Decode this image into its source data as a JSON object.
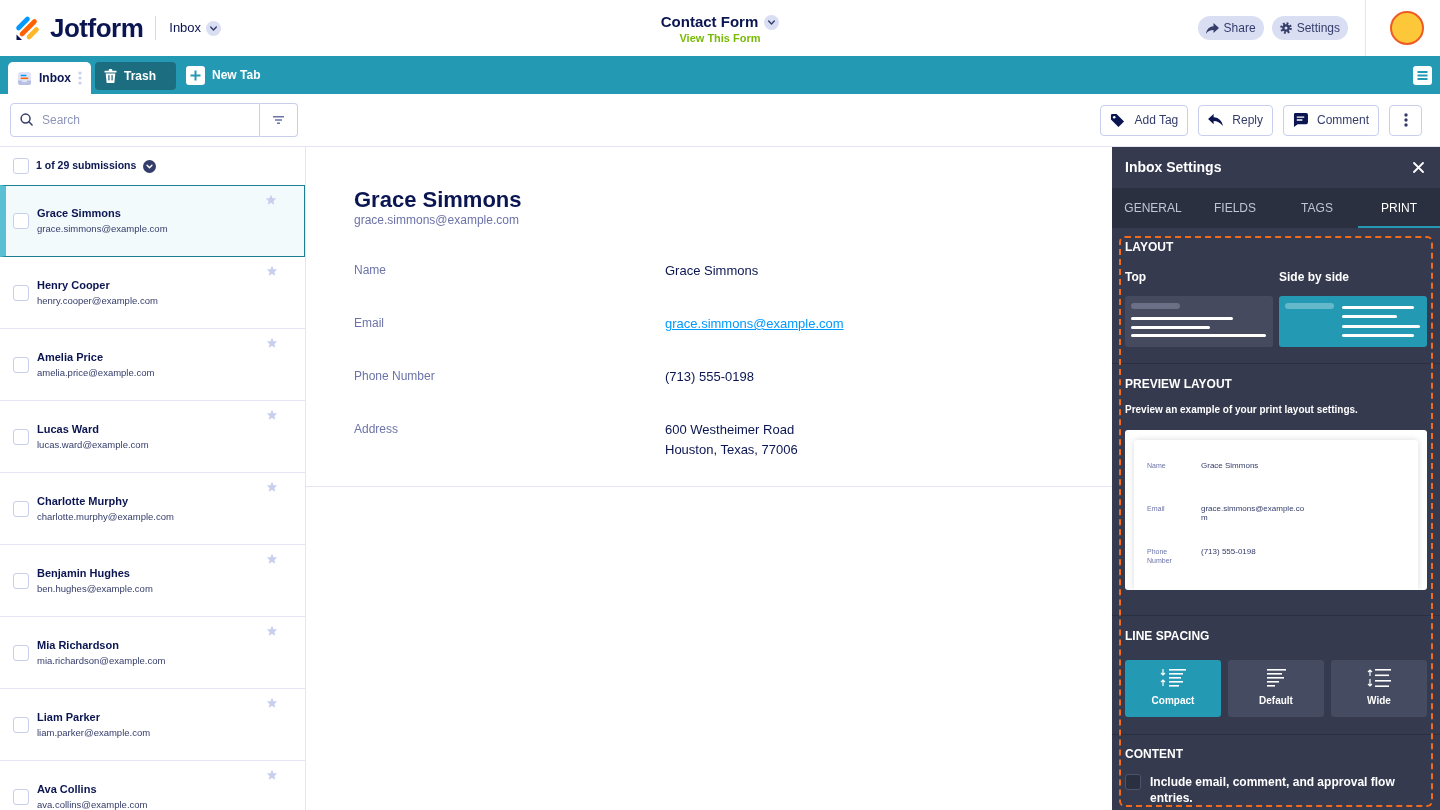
{
  "header": {
    "logo": "Jotform",
    "section_dropdown": "Inbox",
    "form_title": "Contact Form",
    "form_link": "View This Form",
    "buttons": [
      {
        "label": "Share",
        "kind": "share"
      },
      {
        "label": "Settings",
        "kind": "settings"
      }
    ]
  },
  "tabs": [
    {
      "label": "Inbox",
      "kind": "inbox",
      "selected": true
    },
    {
      "label": "Trash",
      "kind": "trash",
      "selected": false
    }
  ],
  "new_tab_button": "New Tab",
  "search": {
    "placeholder": "Search"
  },
  "actions": [
    {
      "label": "Add Tag",
      "kind": "tag"
    },
    {
      "label": "Reply",
      "kind": "reply"
    },
    {
      "label": "Comment",
      "kind": "comment"
    }
  ],
  "submissions": {
    "count": "1 of 29 submissions",
    "all_checked": false,
    "items": [
      {
        "name": "Grace Simmons",
        "email": "grace.simmons@example.com",
        "selected": true,
        "checked": false,
        "starred": false
      },
      {
        "name": "Henry Cooper",
        "email": "henry.cooper@example.com",
        "selected": false,
        "checked": false,
        "starred": false
      },
      {
        "name": "Amelia Price",
        "email": "amelia.price@example.com",
        "selected": false,
        "checked": false,
        "starred": false
      },
      {
        "name": "Lucas Ward",
        "email": "lucas.ward@example.com",
        "selected": false,
        "checked": false,
        "starred": false
      },
      {
        "name": "Charlotte Murphy",
        "email": "charlotte.murphy@example.com",
        "selected": false,
        "checked": false,
        "starred": false
      },
      {
        "name": "Benjamin Hughes",
        "email": "ben.hughes@example.com",
        "selected": false,
        "checked": false,
        "starred": false
      },
      {
        "name": "Mia Richardson",
        "email": "mia.richardson@example.com",
        "selected": false,
        "checked": false,
        "starred": false
      },
      {
        "name": "Liam Parker",
        "email": "liam.parker@example.com",
        "selected": false,
        "checked": false,
        "starred": false
      },
      {
        "name": "Ava Collins",
        "email": "ava.collins@example.com",
        "selected": false,
        "checked": false,
        "starred": false
      }
    ]
  },
  "detail": {
    "name": "Grace Simmons",
    "email": "grace.simmons@example.com",
    "fields": [
      {
        "label": "Name",
        "kind": "text",
        "lines": [
          "Grace Simmons"
        ]
      },
      {
        "label": "Email",
        "kind": "link",
        "lines": [
          "grace.simmons@example.com"
        ]
      },
      {
        "label": "Phone Number",
        "kind": "text",
        "lines": [
          "(713) 555-0198"
        ]
      },
      {
        "label": "Address",
        "kind": "text",
        "lines": [
          "600 Westheimer Road",
          "Houston, Texas, 77006"
        ]
      }
    ]
  },
  "settings_panel": {
    "title": "Inbox Settings",
    "tabs": [
      {
        "label": "GENERAL",
        "selected": false
      },
      {
        "label": "FIELDS",
        "selected": false
      },
      {
        "label": "TAGS",
        "selected": false
      },
      {
        "label": "PRINT",
        "selected": true
      }
    ],
    "highlighted": true,
    "layout": {
      "heading": "LAYOUT",
      "options": [
        {
          "label": "Top",
          "kind": "top",
          "selected": false
        },
        {
          "label": "Side by side",
          "kind": "side_by_side",
          "selected": true
        }
      ]
    },
    "preview": {
      "heading": "PREVIEW LAYOUT",
      "description": "Preview an example of your print layout settings.",
      "rows": [
        {
          "label": "Name",
          "value": "Grace Simmons"
        },
        {
          "label": "Email",
          "value": "grace.simmons@example.com"
        },
        {
          "label": "Phone Number",
          "value": "(713) 555-0198"
        }
      ]
    },
    "line_spacing": {
      "heading": "LINE SPACING",
      "options": [
        {
          "label": "Compact",
          "kind": "compact",
          "selected": true
        },
        {
          "label": "Default",
          "kind": "default",
          "selected": false
        },
        {
          "label": "Wide",
          "kind": "wide",
          "selected": false
        }
      ]
    },
    "content": {
      "heading": "CONTENT",
      "option": {
        "label": "Include email, comment, and approval flow entries.",
        "checked": false
      }
    }
  }
}
